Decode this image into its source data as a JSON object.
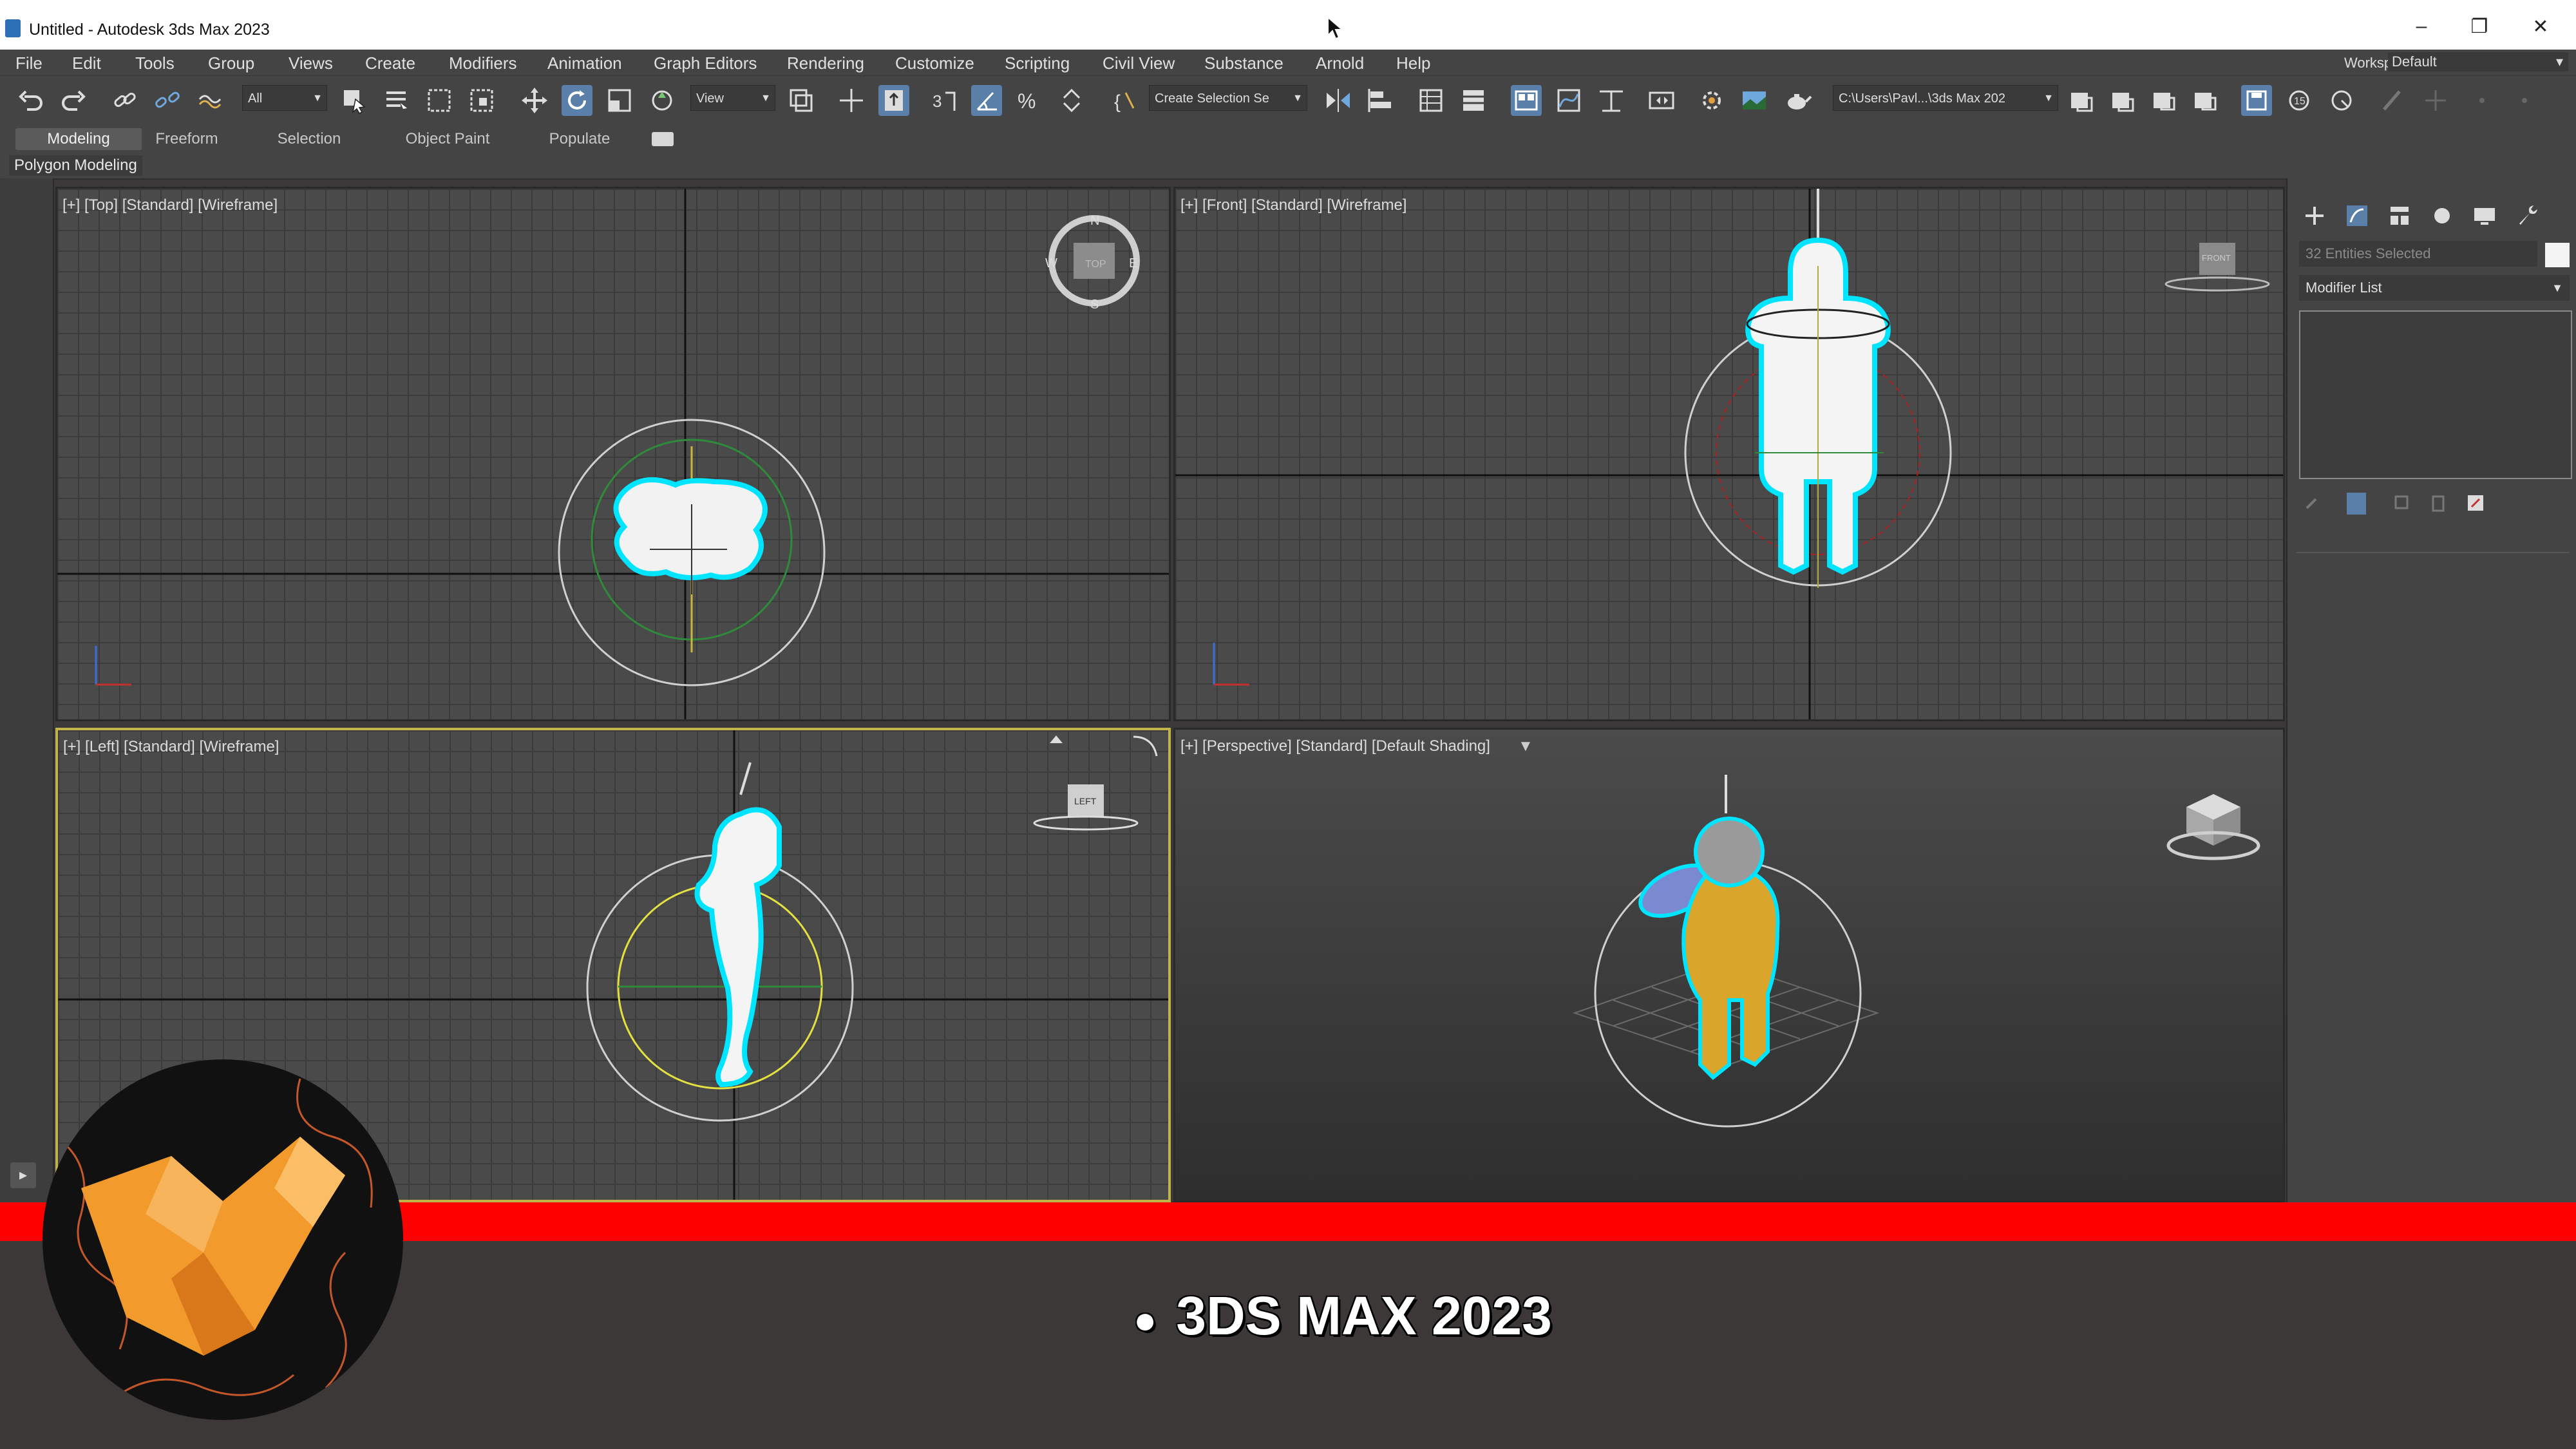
{
  "window": {
    "title": "Untitled - Autodesk 3ds Max 2023",
    "controls": [
      "–",
      "❐",
      "✕"
    ]
  },
  "menu": {
    "items": [
      "File",
      "Edit",
      "Tools",
      "Group",
      "Views",
      "Create",
      "Modifiers",
      "Animation",
      "Graph Editors",
      "Rendering",
      "Customize",
      "Scripting",
      "Civil View",
      "Substance",
      "Arnold",
      "Help"
    ],
    "workspaces_label": "Workspaces:",
    "workspaces_value": "Default"
  },
  "toolbar": {
    "selection_filter": "All",
    "reference_coord": "View",
    "named_selection": "Create Selection Se",
    "project_path": "C:\\Users\\Pavl...\\3ds Max 202"
  },
  "ribbon": {
    "tabs": [
      "Modeling",
      "Freeform",
      "Selection",
      "Object Paint",
      "Populate"
    ],
    "active_tab": "Modeling",
    "sub_label": "Polygon Modeling"
  },
  "viewports": {
    "top": {
      "label": "[+] [Top] [Standard] [Wireframe]",
      "viewcube": "TOP"
    },
    "front": {
      "label": "[+] [Front] [Standard] [Wireframe]",
      "viewcube": "FRONT"
    },
    "left": {
      "label": "[+] [Left] [Standard] [Wireframe]",
      "viewcube": "LEFT"
    },
    "perspective": {
      "label": "[+] [Perspective] [Standard] [Default Shading]"
    }
  },
  "compass": {
    "n": "N",
    "s": "S",
    "e": "E",
    "w": "W"
  },
  "command_panel": {
    "selection_text": "32 Entities Selected",
    "modifier_list": "Modifier List"
  },
  "overlay": {
    "caption": "3DS MAX 2023",
    "colors": {
      "band": "#ff0000",
      "logo_orange": "#f39a2c"
    }
  }
}
